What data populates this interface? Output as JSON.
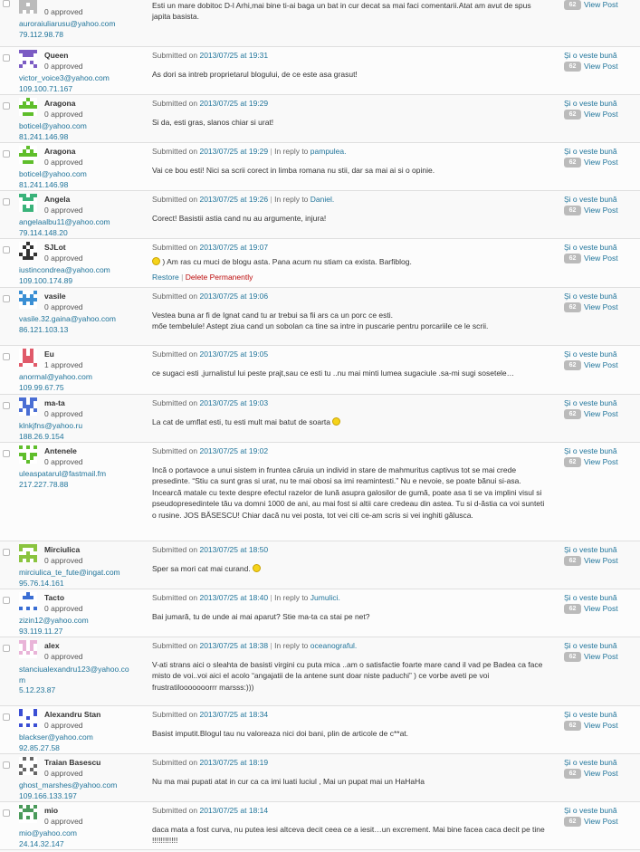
{
  "post": {
    "title": "Și o veste bună",
    "count": "62",
    "view_label": "View Post"
  },
  "labels": {
    "submitted_on": "Submitted on",
    "at": "at",
    "in_reply_to": "In reply to",
    "restore": "Restore",
    "delete_permanently": "Delete Permanently"
  },
  "comments": [
    {
      "author": "",
      "status": "0 approved",
      "email": "auroraiuliarusu@yahoo.com",
      "ip": "79.112.98.78",
      "date": "",
      "reply_to": "",
      "text": "Esti un mare dobitoc D-l Arhi,mai bine ti-ai baga un bat in cur decat sa mai faci comentarii.Atat am avut de spus japita basista."
    },
    {
      "author": "Queen",
      "status": "0 approved",
      "email": "victor_voice3@yahoo.com",
      "ip": "109.100.71.167",
      "date": "2013/07/25",
      "time": "19:31",
      "reply_to": "",
      "text": "As dori sa intreb proprietarul blogului, de ce este asa grasut!"
    },
    {
      "author": "Aragona",
      "status": "0 approved",
      "email": "boticel@yahoo.com",
      "ip": "81.241.146.98",
      "date": "2013/07/25",
      "time": "19:29",
      "reply_to": "",
      "text": "Si da, esti gras, slanos chiar si urat!"
    },
    {
      "author": "Aragona",
      "status": "0 approved",
      "email": "boticel@yahoo.com",
      "ip": "81.241.146.98",
      "date": "2013/07/25",
      "time": "19:29",
      "reply_to": "pampulea.",
      "text": "Vai ce bou esti! Nici sa scrii corect in limba romana nu stii, dar sa mai ai si o opinie."
    },
    {
      "author": "Angela",
      "status": "0 approved",
      "email": "angelaalbu11@yahoo.com",
      "ip": "79.114.148.20",
      "date": "2013/07/25",
      "time": "19:26",
      "reply_to": "Daniel.",
      "text": "Corect! Basistii astia cand nu au argumente, injura!"
    },
    {
      "author": "SJLot",
      "status": "0 approved",
      "email": "iustincondrea@yahoo.com",
      "ip": "109.100.174.89",
      "date": "2013/07/25",
      "time": "19:07",
      "reply_to": "",
      "text": ") Am ras cu muci de blogu asta. Pana acum nu stiam ca exista. Barfiblog."
    },
    {
      "author": "vasile",
      "status": "0 approved",
      "email": "vasile.32.gaina@yahoo.com",
      "ip": "86.121.103.13",
      "date": "2013/07/25",
      "time": "19:06",
      "reply_to": "",
      "text": "Vestea buna ar fi de Ignat cand tu ar trebui sa fii ars ca un porc ce esti.\nmőe tembelule! Astept ziua cand un sobolan ca tine sa intre in puscarie pentru porcariile ce le scrii."
    },
    {
      "author": "Eu",
      "status": "1 approved",
      "email": "anormal@yahoo.com",
      "ip": "109.99.67.75",
      "date": "2013/07/25",
      "time": "19:05",
      "reply_to": "",
      "text": "ce sugaci esti ,jurnalistul lui peste prajt,sau ce esti tu ..nu mai minti lumea sugaciule .sa-mi sugi sosetele…"
    },
    {
      "author": "ma-ta",
      "status": "0 approved",
      "email": "klnkjfns@yahoo.ru",
      "ip": "188.26.9.154",
      "date": "2013/07/25",
      "time": "19:03",
      "reply_to": "",
      "text": "La cat de umflat esti, tu esti mult mai batut de soarta"
    },
    {
      "author": "Antenele",
      "status": "0 approved",
      "email": "uleaspatarul@fastmail.fm",
      "ip": "217.227.78.88",
      "date": "2013/07/25",
      "time": "19:02",
      "reply_to": "",
      "text": "Incă o portavoce a unui sistem in fruntea căruia un individ in stare de mahmuritus captivus tot se mai crede presedinte. “Stiu ca sunt gras si urat, nu te mai obosi sa imi reamintesti.” Nu e nevoie, se poate bănui si-asa. Incearcă matale cu texte despre efectul razelor de lună asupra galosilor de gumă, poate asa ti se va implini visul si pseudopresedintele tău va domni 1000 de ani, au mai fost si altii care credeau din astea. Tu si d-ăstia ca voi sunteti o rusine. JOS BĂSESCU! Chiar dacă nu vei posta, tot vei citi ce-am scris si vei inghiti gălusca."
    },
    {
      "author": "Mirciulica",
      "status": "0 approved",
      "email": "mirciulica_te_fute@ingat.com",
      "ip": "95.76.14.161",
      "date": "2013/07/25",
      "time": "18:50",
      "reply_to": "",
      "text": "Sper sa mori cat mai curand."
    },
    {
      "author": "Tacto",
      "status": "0 approved",
      "email": "zizin12@yahoo.com",
      "ip": "93.119.11.27",
      "date": "2013/07/25",
      "time": "18:40",
      "reply_to": "Jumulici.",
      "text": "Bai jumară, tu de unde ai mai aparut? Stie ma-ta ca stai pe net?"
    },
    {
      "author": "alex",
      "status": "0 approved",
      "email": "stanciualexandru123@yahoo.com",
      "ip": "5.12.23.87",
      "date": "2013/07/25",
      "time": "18:38",
      "reply_to": "oceanograful.",
      "text": "V-ati strans aici o sleahta de basisti virgini cu puta mica ..am o satisfactie foarte mare cand il vad pe Badea ca face misto de voi..voi aici el acolo “angajatii de la antene sunt doar niste paduchi” ) ce vorbe aveti pe voi frustratilooooooorrr marsss:)))"
    },
    {
      "author": "Alexandru Stan",
      "status": "0 approved",
      "email": "blackser@yahoo.com",
      "ip": "92.85.27.58",
      "date": "2013/07/25",
      "time": "18:34",
      "reply_to": "",
      "text": "Basist imputit.Blogul tau nu valoreaza nici doi bani, plin de articole de c**at."
    },
    {
      "author": "Traian Basescu",
      "status": "0 approved",
      "email": "ghost_marshes@yahoo.com",
      "ip": "109.166.133.197",
      "date": "2013/07/25",
      "time": "18:19",
      "reply_to": "",
      "text": "Nu ma mai pupati atat in cur ca ca imi luati luciul , Mai un pupat mai un HaHaHa"
    },
    {
      "author": "mio",
      "status": "0 approved",
      "email": "mio@yahoo.com",
      "ip": "24.14.32.147",
      "date": "2013/07/25",
      "time": "18:14",
      "reply_to": "",
      "text": "daca mata a fost curva, nu putea iesi altceva decit ceea ce a iesit…un excrement. Mai bine facea caca decit pe tine !!!!!!!!!!!!"
    }
  ]
}
